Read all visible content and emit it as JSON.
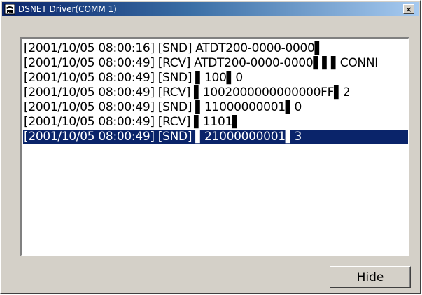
{
  "window": {
    "title": "DSNET Driver(COMM 1)",
    "close_label": "×",
    "icon": "telephone-icon"
  },
  "log": {
    "rows": [
      {
        "text": "[2001/10/05 08:00:16] [SND] ATDT200-0000-0000▌",
        "selected": false
      },
      {
        "text": "[2001/10/05 08:00:49] [RCV] ATDT200-0000-0000▌▌▌CONNI",
        "selected": false
      },
      {
        "text": "[2001/10/05 08:00:49] [SND] ▌100▌0",
        "selected": false
      },
      {
        "text": "[2001/10/05 08:00:49] [RCV] ▌1002000000000000FF▌2",
        "selected": false
      },
      {
        "text": "[2001/10/05 08:00:49] [SND] ▌11000000001▌0",
        "selected": false
      },
      {
        "text": "[2001/10/05 08:00:49] [RCV] ▌1101▌",
        "selected": false
      },
      {
        "text": "[2001/10/05 08:00:49] [SND] ▌21000000001▌3",
        "selected": true
      }
    ]
  },
  "buttons": {
    "hide_label": "Hide"
  },
  "colors": {
    "titlebar_start": "#0a246a",
    "titlebar_end": "#a6caf0",
    "selection": "#0a246a",
    "face": "#d4d0c8"
  }
}
